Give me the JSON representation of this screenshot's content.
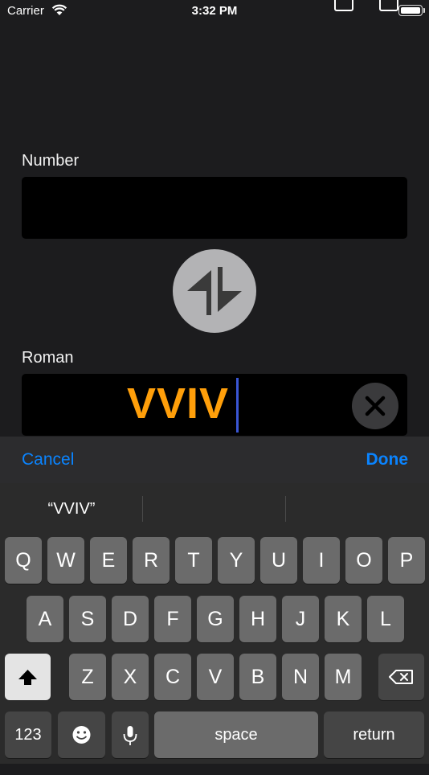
{
  "status_bar": {
    "carrier": "Carrier",
    "time": "3:32 PM"
  },
  "number_field": {
    "label": "Number",
    "value": ""
  },
  "swap_button": {
    "icon": "swap-arrows-icon"
  },
  "roman_field": {
    "label": "Roman",
    "value": "VVIV",
    "clear_icon": "clear-icon"
  },
  "toolbar": {
    "cancel_label": "Cancel",
    "done_label": "Done"
  },
  "keyboard": {
    "suggestions": [
      "“VVIV”",
      "",
      ""
    ],
    "row1": [
      "Q",
      "W",
      "E",
      "R",
      "T",
      "Y",
      "U",
      "I",
      "O",
      "P"
    ],
    "row2": [
      "A",
      "S",
      "D",
      "F",
      "G",
      "H",
      "J",
      "K",
      "L"
    ],
    "row3": [
      "Z",
      "X",
      "C",
      "V",
      "B",
      "N",
      "M"
    ],
    "numbers_label": "123",
    "space_label": "space",
    "return_label": "return"
  },
  "colors": {
    "accent": "#0a84ff",
    "value_orange": "#ff9f0a",
    "background": "#1c1c1e"
  }
}
